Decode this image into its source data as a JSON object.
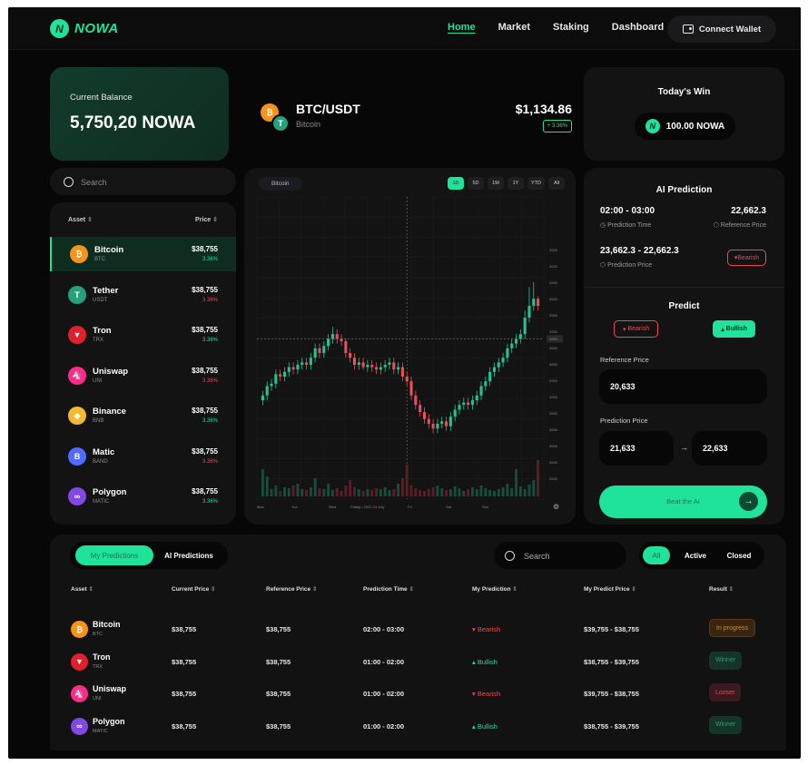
{
  "nav": {
    "logo_text": "NOWA",
    "links": [
      "Home",
      "Market",
      "Staking",
      "Dashboard"
    ],
    "connect_wallet": "Connect Wallet"
  },
  "balance": {
    "label": "Current Balance",
    "value": "5,750,20 NOWA"
  },
  "pair": {
    "title": "BTC/USDT",
    "subtitle": "Bitcoin",
    "price": "$1,134.86",
    "change": "+ 3.36%"
  },
  "todays_win": {
    "title": "Today's Win",
    "value": "100.00 NOWA"
  },
  "asset_search": {
    "placeholder": "Search"
  },
  "asset_list": {
    "col_asset": "Asset",
    "col_price": "Price",
    "items": [
      {
        "name": "Bitcoin",
        "symbol": "BTC",
        "price": "$38,755",
        "change": "3.36%",
        "direction": "up",
        "color": "#f7931a",
        "glyph": "₿"
      },
      {
        "name": "Tether",
        "symbol": "USDT",
        "price": "$38,755",
        "change": "3.36%",
        "direction": "down",
        "color": "#26a17b",
        "glyph": "T"
      },
      {
        "name": "Tron",
        "symbol": "TRX",
        "price": "$38,755",
        "change": "3.36%",
        "direction": "up",
        "color": "#e0202e",
        "glyph": "▼"
      },
      {
        "name": "Uniswap",
        "symbol": "UNI",
        "price": "$38,755",
        "change": "3.36%",
        "direction": "down",
        "color": "#ff2a8a",
        "glyph": "🦄"
      },
      {
        "name": "Binance",
        "symbol": "BNB",
        "price": "$38,755",
        "change": "3.36%",
        "direction": "up",
        "color": "#f3ba2f",
        "glyph": "◆"
      },
      {
        "name": "Matic",
        "symbol": "BAND",
        "price": "$38,755",
        "change": "3.36%",
        "direction": "down",
        "color": "#516aff",
        "glyph": "B"
      },
      {
        "name": "Polygon",
        "symbol": "MATIC",
        "price": "$38,755",
        "change": "3.36%",
        "direction": "up",
        "color": "#8247e5",
        "glyph": "∞"
      }
    ]
  },
  "chart": {
    "tag": "Bitcoin",
    "timeframes": [
      "1D",
      "5D",
      "1M",
      "1Y",
      "YTD",
      "All"
    ],
    "x_labels": [
      "Mon",
      "Tue",
      "Wed",
      "Friday • 2022 24 July",
      "Fri",
      "Sat",
      "Sun"
    ],
    "y_labels": [
      "2000",
      "2000",
      "2000",
      "2000",
      "2000",
      "2000",
      "2000",
      "2000",
      "2000",
      "2000",
      "2000",
      "2000",
      "2000",
      "2000",
      "2000"
    ],
    "current_label": "2000"
  },
  "chart_data": {
    "type": "candlestick",
    "open": [
      40,
      42,
      46,
      47,
      51,
      50,
      52,
      54,
      53,
      55,
      56,
      55,
      58,
      62,
      60,
      63,
      66,
      68,
      66,
      65,
      60,
      58,
      55,
      56,
      54,
      55,
      54,
      53,
      54,
      55,
      56,
      53,
      54,
      50,
      48,
      42,
      38,
      35,
      32,
      30,
      28,
      30,
      31,
      29,
      33,
      36,
      38,
      39,
      38,
      40,
      42,
      46,
      48,
      52,
      54,
      56,
      58,
      62,
      64,
      66,
      68,
      75,
      80,
      83
    ],
    "close": [
      42,
      46,
      47,
      51,
      50,
      52,
      54,
      53,
      55,
      56,
      55,
      58,
      62,
      60,
      63,
      66,
      68,
      66,
      65,
      60,
      58,
      55,
      56,
      54,
      55,
      54,
      53,
      54,
      55,
      56,
      53,
      54,
      50,
      48,
      42,
      38,
      35,
      32,
      30,
      28,
      30,
      31,
      29,
      33,
      36,
      38,
      39,
      38,
      40,
      42,
      46,
      48,
      52,
      54,
      56,
      58,
      62,
      64,
      66,
      68,
      75,
      80,
      83,
      80
    ],
    "high": [
      44,
      48,
      49,
      53,
      53,
      54,
      56,
      56,
      57,
      58,
      58,
      60,
      64,
      64,
      65,
      68,
      71,
      70,
      68,
      66,
      62,
      60,
      58,
      58,
      57,
      57,
      56,
      56,
      57,
      58,
      58,
      56,
      56,
      52,
      50,
      44,
      40,
      37,
      34,
      32,
      32,
      33,
      33,
      35,
      38,
      40,
      41,
      41,
      42,
      44,
      48,
      50,
      54,
      56,
      58,
      60,
      64,
      66,
      68,
      70,
      78,
      88,
      90,
      84
    ],
    "low": [
      38,
      40,
      44,
      45,
      48,
      48,
      50,
      51,
      51,
      53,
      53,
      53,
      56,
      58,
      58,
      61,
      64,
      64,
      63,
      58,
      56,
      53,
      53,
      53,
      52,
      52,
      51,
      51,
      52,
      53,
      51,
      51,
      48,
      46,
      40,
      36,
      33,
      30,
      28,
      26,
      26,
      28,
      27,
      27,
      31,
      34,
      36,
      36,
      36,
      38,
      40,
      44,
      46,
      50,
      52,
      54,
      56,
      60,
      62,
      64,
      66,
      73,
      78,
      78
    ],
    "volume": [
      30,
      22,
      8,
      12,
      6,
      10,
      9,
      12,
      14,
      8,
      7,
      10,
      20,
      9,
      8,
      14,
      7,
      9,
      6,
      12,
      18,
      10,
      8,
      6,
      8,
      7,
      9,
      8,
      10,
      7,
      8,
      14,
      20,
      35,
      12,
      9,
      7,
      6,
      8,
      10,
      12,
      9,
      7,
      8,
      11,
      9,
      6,
      8,
      10,
      8,
      12,
      9,
      7,
      6,
      8,
      10,
      14,
      9,
      30,
      11,
      8,
      13,
      18,
      40
    ],
    "ylim": [
      0,
      100
    ]
  },
  "ai": {
    "title": "AI Prediction",
    "prediction_time": "02:00 - 03:00",
    "prediction_time_label": "Prediction Time",
    "reference_price": "22,662.3",
    "reference_price_label": "Reference Price",
    "prediction_price": "23,662.3 - 22,662.3",
    "prediction_price_label": "Prediction Price",
    "direction": "Bearish",
    "predict_title": "Predict",
    "bearish_btn": "Bearish",
    "bullish_btn": "Bullish",
    "ref_label": "Reference Price",
    "ref_value": "20,633",
    "pred_label": "Prediction Price",
    "pred_from": "21,633",
    "pred_to": "22,633",
    "beat_btn": "Beat the AI"
  },
  "predictions": {
    "tab_mine": "My Predictions",
    "tab_ai": "AI Predictions",
    "search_placeholder": "Search",
    "filters": [
      "All",
      "Active",
      "Closed"
    ],
    "columns": [
      "Asset",
      "Current Price",
      "Reference Price",
      "Prediction Time",
      "My Prediction",
      "My Predict Price",
      "Result"
    ],
    "rows": [
      {
        "name": "Bitcoin",
        "symbol": "BTC",
        "color": "#f7931a",
        "glyph": "₿",
        "current": "$38,755",
        "reference": "$38,755",
        "time": "02:00 - 03:00",
        "prediction": "Bearish",
        "pred_dir": "down",
        "predict_price": "$39,755 - $38,755",
        "result": "In progress",
        "result_type": "progress"
      },
      {
        "name": "Tron",
        "symbol": "TRX",
        "color": "#e0202e",
        "glyph": "▼",
        "current": "$38,755",
        "reference": "$38,755",
        "time": "01:00 - 02:00",
        "prediction": "Bullish",
        "pred_dir": "up",
        "predict_price": "$38,755 - $39,755",
        "result": "Winner",
        "result_type": "winner"
      },
      {
        "name": "Uniswap",
        "symbol": "UNI",
        "color": "#ff2a8a",
        "glyph": "🦄",
        "current": "$38,755",
        "reference": "$38,755",
        "time": "01:00 - 02:00",
        "prediction": "Bearish",
        "pred_dir": "down",
        "predict_price": "$39,755 - $38,755",
        "result": "Looser",
        "result_type": "loser"
      },
      {
        "name": "Polygon",
        "symbol": "MATIC",
        "color": "#8247e5",
        "glyph": "∞",
        "current": "$38,755",
        "reference": "$38,755",
        "time": "01:00 - 02:00",
        "prediction": "Bullish",
        "pred_dir": "up",
        "predict_price": "$38,755 - $39,755",
        "result": "Winner",
        "result_type": "winner"
      }
    ]
  }
}
